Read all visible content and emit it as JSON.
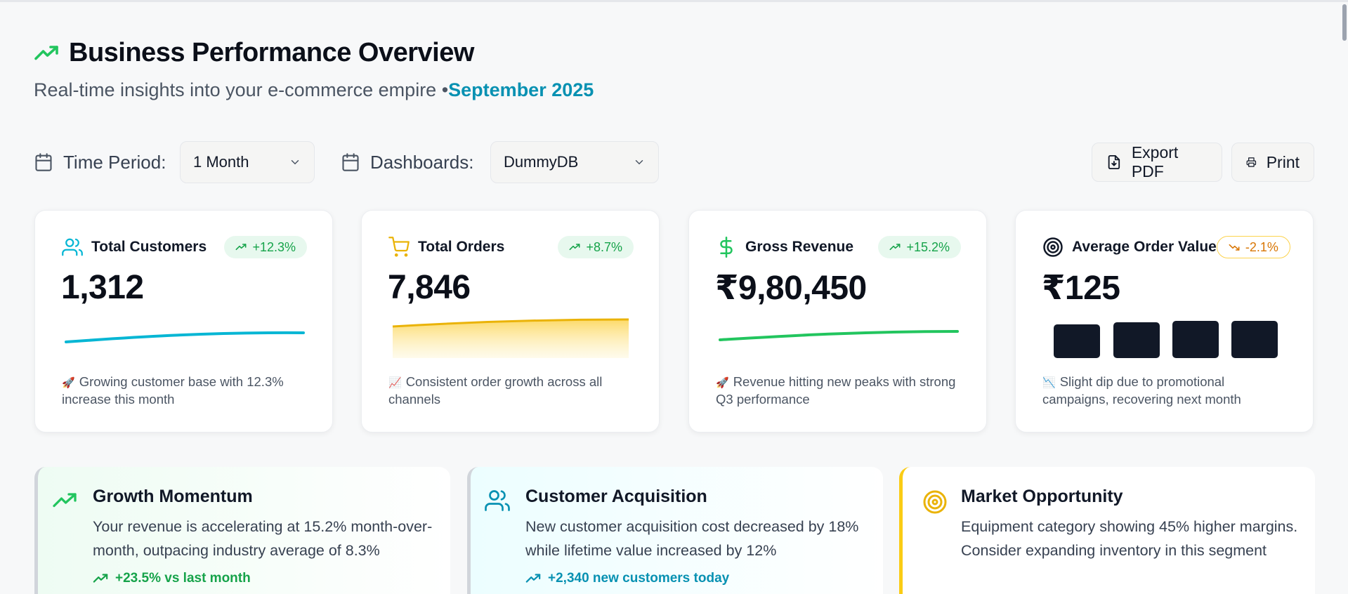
{
  "header": {
    "title": "Business Performance Overview",
    "subtitle": "Real-time insights into your e-commerce empire •",
    "period": "September 2025"
  },
  "controls": {
    "time_period_label": "Time Period:",
    "time_period_value": "1 Month",
    "dashboards_label": "Dashboards:",
    "dashboards_value": "DummyDB",
    "export_label": "Export PDF",
    "print_label": "Print"
  },
  "kpis": [
    {
      "title": "Total Customers",
      "badge": "+12.3%",
      "trend": "up",
      "value": "1,312",
      "emoji": "🚀",
      "note": "Growing customer base with 12.3% increase this month",
      "color": "#06b6d4",
      "icon": "users-icon"
    },
    {
      "title": "Total Orders",
      "badge": "+8.7%",
      "trend": "up",
      "value": "7,846",
      "emoji": "📈",
      "note": "Consistent order growth across all channels",
      "color": "#eab308",
      "icon": "cart-icon"
    },
    {
      "title": "Gross Revenue",
      "badge": "+15.2%",
      "trend": "up",
      "value": "₹9,80,450",
      "emoji": "🚀",
      "note": "Revenue hitting new peaks with strong Q3 performance",
      "color": "#22c55e",
      "icon": "dollar-icon"
    },
    {
      "title": "Average Order Value",
      "badge": "-2.1%",
      "trend": "down",
      "value": "₹125",
      "emoji": "📉",
      "note": "Slight dip due to promotional campaigns, recovering next month",
      "color": "#111827",
      "icon": "target-icon"
    }
  ],
  "insights": [
    {
      "title": "Growth Momentum",
      "body": "Your revenue is accelerating at 15.2% month-over-month, outpacing industry average of 8.3%",
      "footer": "+23.5% vs last month",
      "footer_color": "#16a34a",
      "icon": "trending-up-icon"
    },
    {
      "title": "Customer Acquisition",
      "body": "New customer acquisition cost decreased by 18% while lifetime value increased by 12%",
      "footer": "+2,340 new customers today",
      "footer_color": "#0891b2",
      "icon": "users-icon"
    },
    {
      "title": "Market Opportunity",
      "body": "Equipment category showing 45% higher margins. Consider expanding inventory in this segment",
      "footer": "",
      "footer_color": "#ca8a04",
      "icon": "target-icon"
    }
  ],
  "colors": {
    "accent_green": "#22c55e",
    "accent_cyan": "#0891b2",
    "accent_yellow": "#eab308",
    "warning": "#d97706"
  }
}
